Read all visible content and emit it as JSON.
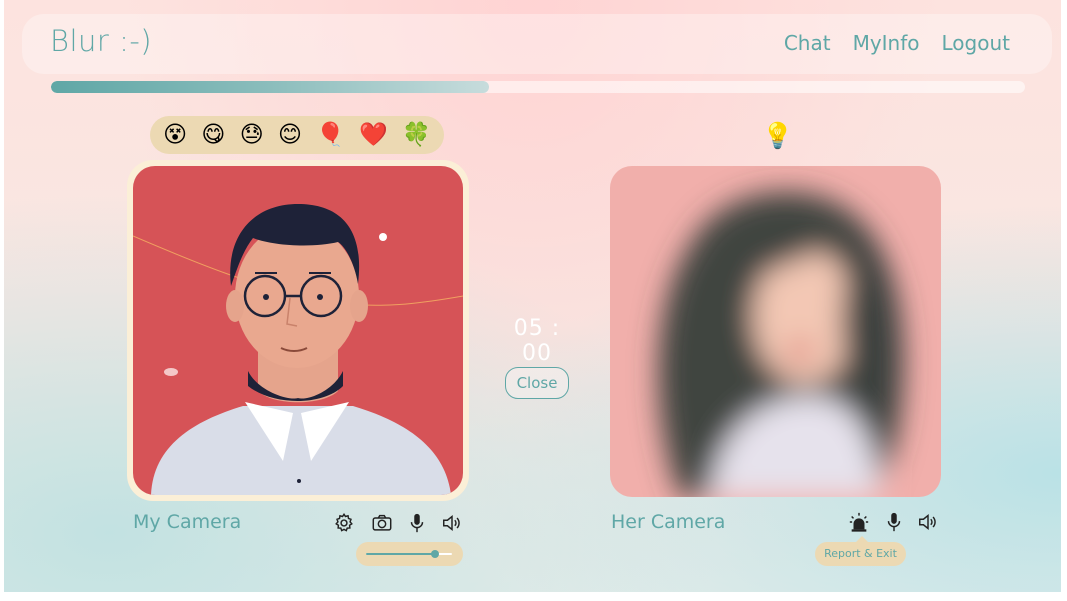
{
  "app": {
    "title": "Blur :-)"
  },
  "nav": {
    "items": [
      "Chat",
      "MyInfo",
      "Logout"
    ]
  },
  "session_progress": {
    "fraction": 0.45
  },
  "reactions": {
    "emojis": [
      "😵",
      "😋",
      "😓",
      "😊",
      "🎈",
      "❤️",
      "🍀"
    ],
    "hint_icon": "lightbulb-icon",
    "hint_glyph": "💡"
  },
  "timer": {
    "display": "05 : 00"
  },
  "close_button": {
    "label": "Close"
  },
  "my_camera": {
    "label": "My Camera",
    "controls": [
      "settings-icon",
      "camera-icon",
      "microphone-icon",
      "speaker-icon"
    ],
    "volume": 0.8
  },
  "her_camera": {
    "label": "Her Camera",
    "controls": [
      "siren-icon",
      "microphone-icon",
      "speaker-icon"
    ],
    "tooltip": "Report & Exit"
  },
  "colors": {
    "accent": "#5fa7a6",
    "pill": "#ecd9b3",
    "my_camera_bg": "#d65357",
    "her_camera_bg": "#f1afab"
  }
}
